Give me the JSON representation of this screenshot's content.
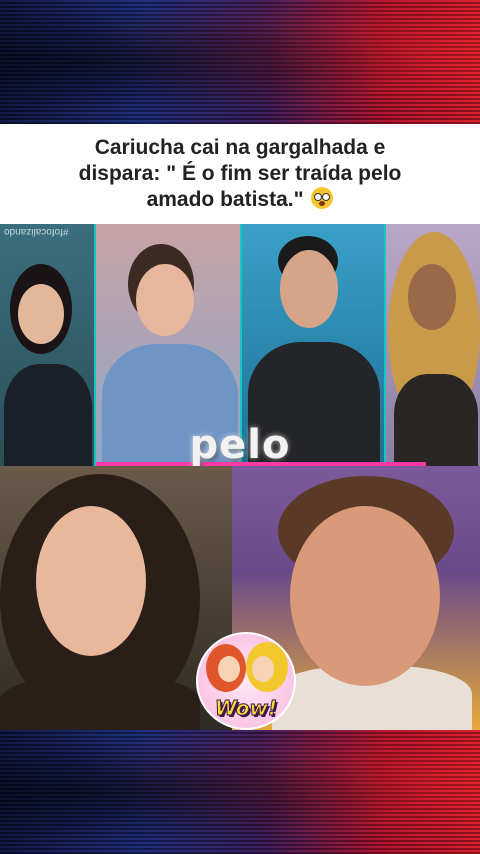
{
  "caption": {
    "line1": "Cariucha cai na gargalhada e",
    "line2": "dispara: \" É o fim ser traída pelo",
    "line3": "amado batista.\""
  },
  "overlay_word": "pelo",
  "watermark": "#fofocalizando",
  "sticker_text": "Wow!",
  "colors": {
    "divider": "#14c7c3",
    "accent_pink": "#ff3aa6",
    "caption_bg": "#ffffff"
  },
  "icons": {
    "emoji": "flushed-face-emoji",
    "sticker": "wow-comic-sticker"
  }
}
